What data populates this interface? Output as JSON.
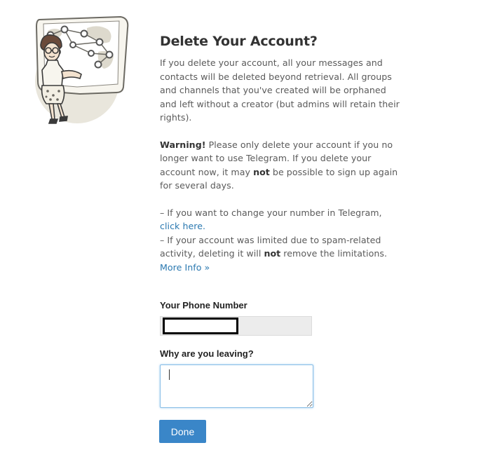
{
  "page": {
    "title": "Delete Your Account?",
    "intro": "If you delete your account, all your messages and contacts will be deleted beyond retrieval. All groups and channels that you've created will be orphaned and left without a creator (but admins will retain their rights).",
    "warning": {
      "strong": "Warning!",
      "text_before_not": " Please only delete your account if you no longer want to use Telegram. If you delete your account now, it may ",
      "not_word": "not",
      "text_after_not": " be possible to sign up again for several days."
    },
    "notes": {
      "change_number_text": "– If you want to change your number in Telegram, ",
      "change_number_link": "click here.",
      "spam_text_before": "– If your account was limited due to spam-related activity, deleting it will ",
      "spam_not_word": "not",
      "spam_text_after": " remove the limitations. ",
      "more_info_link": "More Info »"
    }
  },
  "form": {
    "phone_label": "Your Phone Number",
    "phone_value": "",
    "reason_label": "Why are you leaving?",
    "reason_value": "",
    "done_label": "Done"
  },
  "colors": {
    "link": "#2a78b0",
    "button": "#3a86c8",
    "field_focus_border": "#87bde6"
  },
  "icons": {
    "illustration": "woman-at-network-map-illustration"
  }
}
